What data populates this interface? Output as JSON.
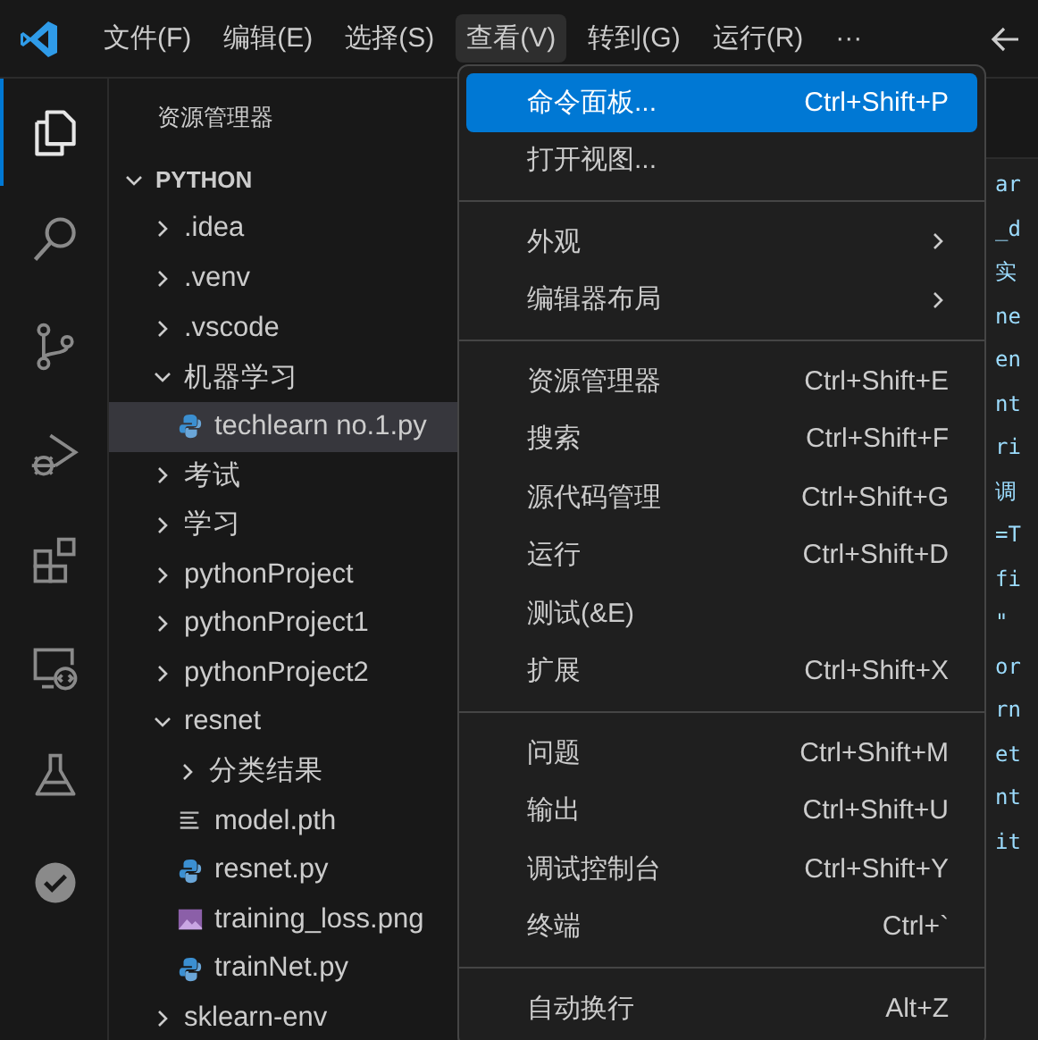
{
  "menubar": [
    {
      "label": "文件(F)",
      "selected": false
    },
    {
      "label": "编辑(E)",
      "selected": false
    },
    {
      "label": "选择(S)",
      "selected": false
    },
    {
      "label": "查看(V)",
      "selected": true
    },
    {
      "label": "转到(G)",
      "selected": false
    },
    {
      "label": "运行(R)",
      "selected": false
    },
    {
      "label": "···",
      "selected": false
    }
  ],
  "activity_bar": [
    {
      "kind": "files",
      "selected": true
    },
    {
      "kind": "search",
      "selected": false
    },
    {
      "kind": "source-control",
      "selected": false
    },
    {
      "kind": "run-debug",
      "selected": false
    },
    {
      "kind": "extensions",
      "selected": false
    },
    {
      "kind": "remote",
      "selected": false
    },
    {
      "kind": "testing",
      "selected": false
    },
    {
      "kind": "check",
      "selected": false
    }
  ],
  "sidebar": {
    "title": "资源管理器",
    "root": {
      "label": "PYTHON",
      "expanded": true
    },
    "items": [
      {
        "label": ".idea",
        "kind": "folder",
        "expanded": false,
        "selected": false
      },
      {
        "label": ".venv",
        "kind": "folder",
        "expanded": false,
        "selected": false
      },
      {
        "label": ".vscode",
        "kind": "folder",
        "expanded": false,
        "selected": false
      },
      {
        "label": "机器学习",
        "kind": "folder",
        "expanded": true,
        "selected": false,
        "children": [
          {
            "label": "techlearn no.1.py",
            "kind": "python",
            "selected": true
          }
        ]
      },
      {
        "label": "考试",
        "kind": "folder",
        "expanded": false,
        "selected": false
      },
      {
        "label": "学习",
        "kind": "folder",
        "expanded": false,
        "selected": false
      },
      {
        "label": "pythonProject",
        "kind": "folder",
        "expanded": false,
        "selected": false
      },
      {
        "label": "pythonProject1",
        "kind": "folder",
        "expanded": false,
        "selected": false
      },
      {
        "label": "pythonProject2",
        "kind": "folder",
        "expanded": false,
        "selected": false
      },
      {
        "label": "resnet",
        "kind": "folder",
        "expanded": true,
        "selected": false,
        "children": [
          {
            "label": "分类结果",
            "kind": "folder",
            "expanded": false,
            "selected": false
          },
          {
            "label": "model.pth",
            "kind": "file",
            "selected": false
          },
          {
            "label": "resnet.py",
            "kind": "python",
            "selected": false
          },
          {
            "label": "training_loss.png",
            "kind": "image",
            "selected": false
          },
          {
            "label": "trainNet.py",
            "kind": "python",
            "selected": false
          }
        ]
      },
      {
        "label": "sklearn-env",
        "kind": "folder",
        "expanded": false,
        "selected": false
      }
    ]
  },
  "editor": {
    "code_fragments": [
      "ar",
      "_d",
      "实",
      "ne",
      "en",
      "nt",
      "ri",
      "调",
      "=T",
      "fi",
      "\"",
      "or",
      "rn",
      "et",
      "nt",
      "it"
    ]
  },
  "view_menu": {
    "groups": [
      [
        {
          "label": "命令面板...",
          "shortcut": "Ctrl+Shift+P",
          "selected": true
        },
        {
          "label": "打开视图...",
          "selected": false
        }
      ],
      [
        {
          "label": "外观",
          "submenu": true,
          "selected": false
        },
        {
          "label": "编辑器布局",
          "submenu": true,
          "selected": false
        }
      ],
      [
        {
          "label": "资源管理器",
          "shortcut": "Ctrl+Shift+E",
          "selected": false
        },
        {
          "label": "搜索",
          "shortcut": "Ctrl+Shift+F",
          "selected": false
        },
        {
          "label": "源代码管理",
          "shortcut": "Ctrl+Shift+G",
          "selected": false
        },
        {
          "label": "运行",
          "shortcut": "Ctrl+Shift+D",
          "selected": false
        },
        {
          "label": "测试(&E)",
          "selected": false
        },
        {
          "label": "扩展",
          "shortcut": "Ctrl+Shift+X",
          "selected": false
        }
      ],
      [
        {
          "label": "问题",
          "shortcut": "Ctrl+Shift+M",
          "selected": false
        },
        {
          "label": "输出",
          "shortcut": "Ctrl+Shift+U",
          "selected": false
        },
        {
          "label": "调试控制台",
          "shortcut": "Ctrl+Shift+Y",
          "selected": false
        },
        {
          "label": "终端",
          "shortcut": "Ctrl+`",
          "selected": false
        }
      ],
      [
        {
          "label": "自动换行",
          "shortcut": "Alt+Z",
          "selected": false
        }
      ]
    ]
  }
}
